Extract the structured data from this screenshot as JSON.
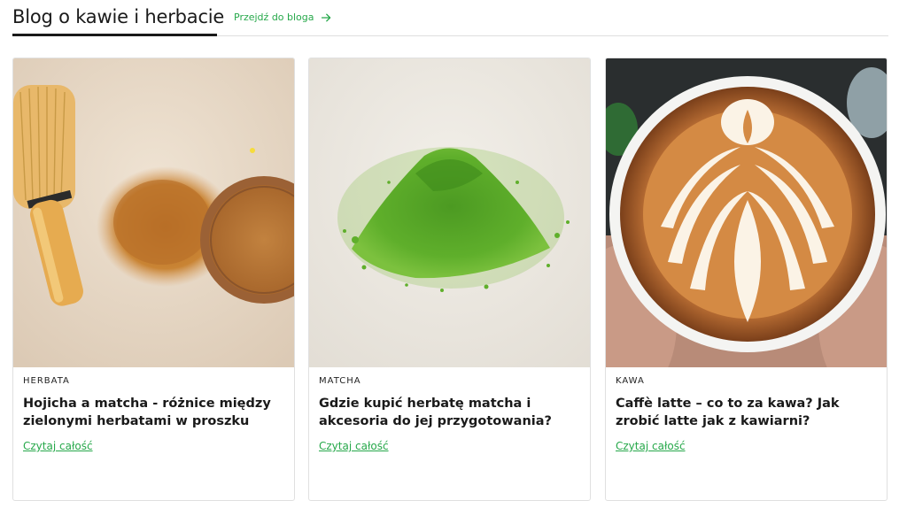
{
  "header": {
    "title": "Blog o kawie i herbacie",
    "link_label": "Przejdź do bloga"
  },
  "colors": {
    "accent": "#26a84a",
    "text": "#1a1a1a",
    "border": "#e0e0e0"
  },
  "posts": [
    {
      "category": "HERBATA",
      "title": "Hojicha a matcha - różnice między zielonymi herbatami w proszku",
      "read_more": "Czytaj całość"
    },
    {
      "category": "MATCHA",
      "title": "Gdzie kupić herbatę matcha i akcesoria do jej przygotowania?",
      "read_more": "Czytaj całość"
    },
    {
      "category": "KAWA",
      "title": "Caffè latte – co to za kawa? Jak zrobić latte jak z kawiarni?",
      "read_more": "Czytaj całość"
    }
  ]
}
